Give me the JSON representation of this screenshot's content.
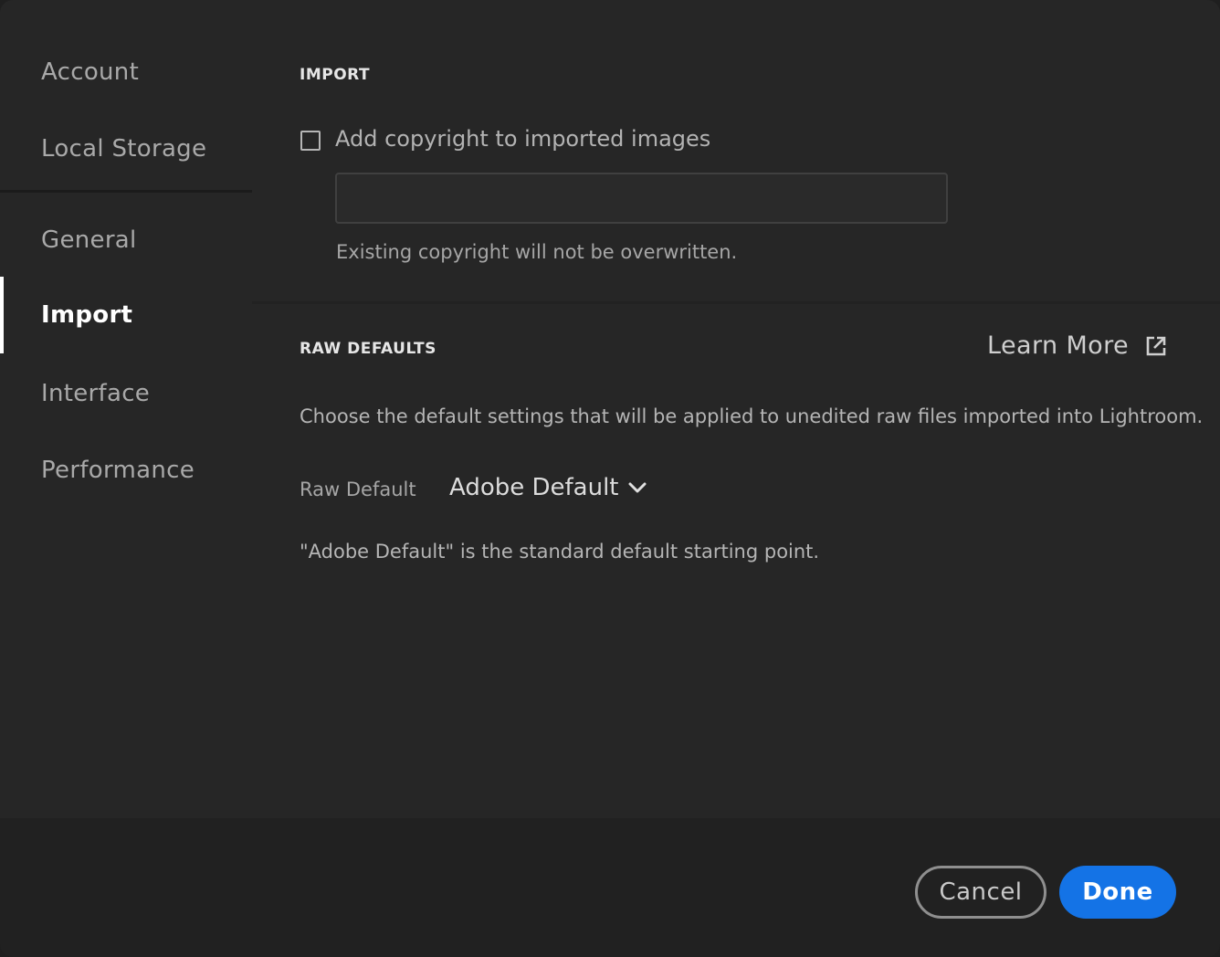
{
  "sidebar": {
    "items": [
      {
        "label": "Account"
      },
      {
        "label": "Local Storage"
      },
      {
        "label": "General"
      },
      {
        "label": "Import",
        "active": true
      },
      {
        "label": "Interface"
      },
      {
        "label": "Performance"
      }
    ]
  },
  "import_section": {
    "heading": "IMPORT",
    "copyright_checkbox": {
      "label": "Add copyright to imported images",
      "checked": false
    },
    "copyright_input": {
      "value": "",
      "placeholder": ""
    },
    "hint": "Existing copyright will not be overwritten."
  },
  "raw_section": {
    "heading": "RAW DEFAULTS",
    "learn_more": "Learn More",
    "learn_more_icon": "external-link-icon",
    "description": "Choose the default settings that will be applied to unedited raw files imported into Lightroom.",
    "raw_default_label": "Raw Default",
    "raw_default_value": "Adobe Default",
    "note": "\"Adobe Default\" is the standard default starting point."
  },
  "footer": {
    "cancel_label": "Cancel",
    "done_label": "Done"
  },
  "colors": {
    "accent": "#1473e6",
    "background": "#262626"
  }
}
